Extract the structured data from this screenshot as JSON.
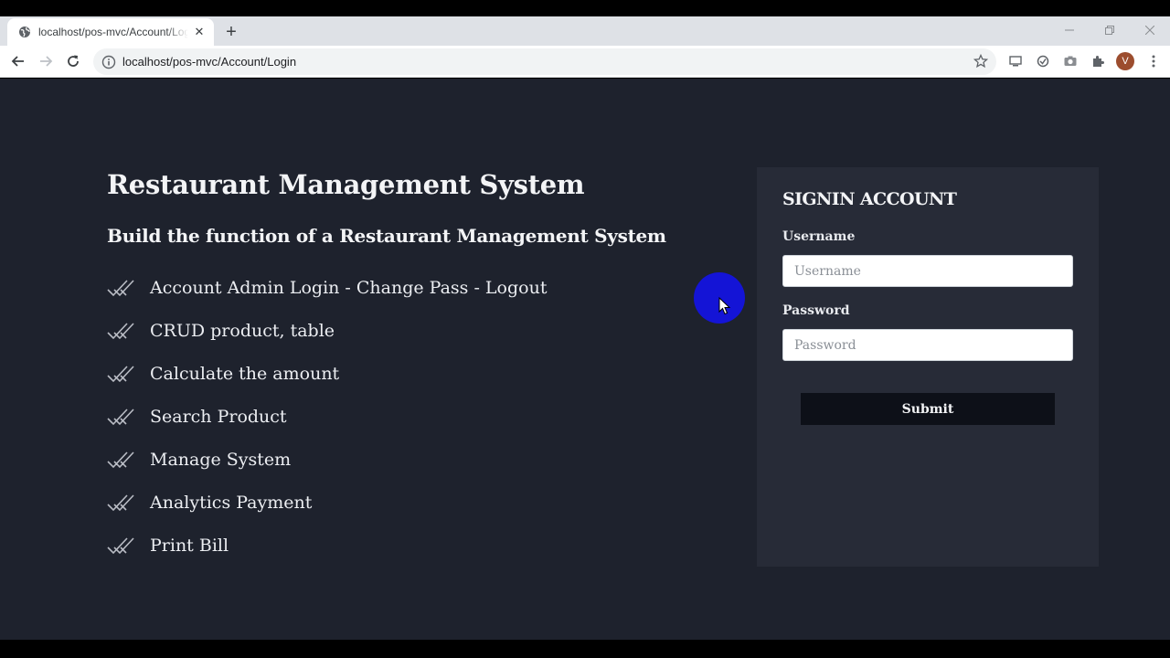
{
  "browser": {
    "tab_title": "localhost/pos-mvc/Account/Login",
    "url": "localhost/pos-mvc/Account/Login",
    "profile_initial": "V",
    "new_tab_label": "+",
    "close_label": "✕"
  },
  "hero": {
    "title": "Restaurant Management System",
    "subtitle": "Build the function of a Restaurant Management System",
    "features": [
      "Account Admin Login - Change Pass - Logout",
      "CRUD product, table",
      "Calculate the amount",
      "Search Product",
      "Manage System",
      "Analytics Payment",
      "Print Bill"
    ]
  },
  "login": {
    "title": "SIGNIN ACCOUNT",
    "username_label": "Username",
    "username_placeholder": "Username",
    "password_label": "Password",
    "password_placeholder": "Password",
    "submit_label": "Submit"
  },
  "colors": {
    "page_background": "#1e222d",
    "panel_background": "#272b37",
    "button_background": "#0d1018",
    "cursor_halo": "#1414d6"
  },
  "icons": {
    "feature_bullet": "double-check-icon",
    "browser": [
      "globe-icon",
      "back-icon",
      "forward-icon",
      "reload-icon",
      "info-icon",
      "star-icon",
      "cast-icon",
      "sync-icon",
      "camera-icon",
      "puzzle-icon",
      "kebab-menu-icon"
    ]
  }
}
